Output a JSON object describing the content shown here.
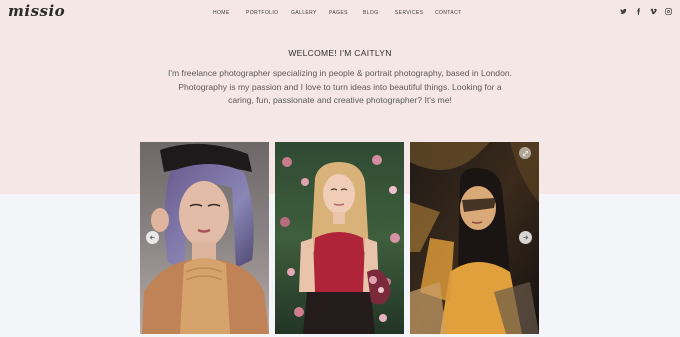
{
  "brand": {
    "logo_text": "missio"
  },
  "nav": {
    "items": [
      "HOME",
      "PORTFOLIO",
      "GALLERY",
      "PAGES",
      "BLOG",
      "SERVICES",
      "CONTACT"
    ]
  },
  "social": [
    "twitter-icon",
    "facebook-icon",
    "vimeo-icon",
    "instagram-icon"
  ],
  "hero": {
    "welcome": "WELCOME! I'M CAITLYN",
    "intro": "I'm freelance photographer specializing in people & portrait photography, based in London. Photography is my passion and I love to turn ideas into beautiful things. Looking for a caring, fun, passionate and creative photographer? It's me!"
  },
  "gallery": {
    "photos": [
      "portrait-lavender-hair",
      "portrait-flower-field",
      "portrait-shadow-light"
    ]
  },
  "colors": {
    "hero_bg": "#f4e7e5",
    "page_bg": "#f4f5f9",
    "text": "#3a3a3a"
  }
}
